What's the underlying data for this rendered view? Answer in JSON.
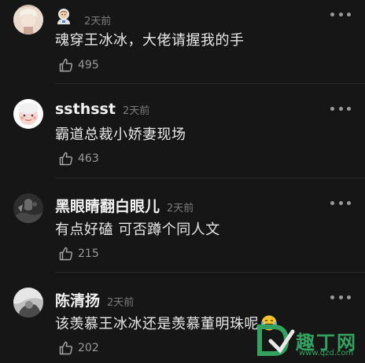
{
  "comments": [
    {
      "username": "",
      "time": "2天前",
      "text": "魂穿王冰冰，大佬请握我的手",
      "likes": "495",
      "badge_icon": "astronaut-emoji-icon"
    },
    {
      "username": "ssthsst",
      "time": "2天前",
      "text": "霸道总裁小娇妻现场",
      "likes": "463"
    },
    {
      "username": "黑眼睛翻白眼儿",
      "time": "2天前",
      "text": "有点好磕  可否蹲个同人文",
      "likes": "215"
    },
    {
      "username": "陈清扬",
      "time": "2天前",
      "text": "该羡慕王冰冰还是羡慕董明珠呢",
      "likes": "202",
      "trailing_emoji": "laughing-tears-emoji-icon"
    }
  ],
  "watermark": {
    "text": "趣丁网",
    "url": "www.qzd.com"
  },
  "colors": {
    "background": "#161616",
    "text": "#e8e8e8",
    "meta": "#7c7c7c",
    "watermark": "#33a15f"
  }
}
